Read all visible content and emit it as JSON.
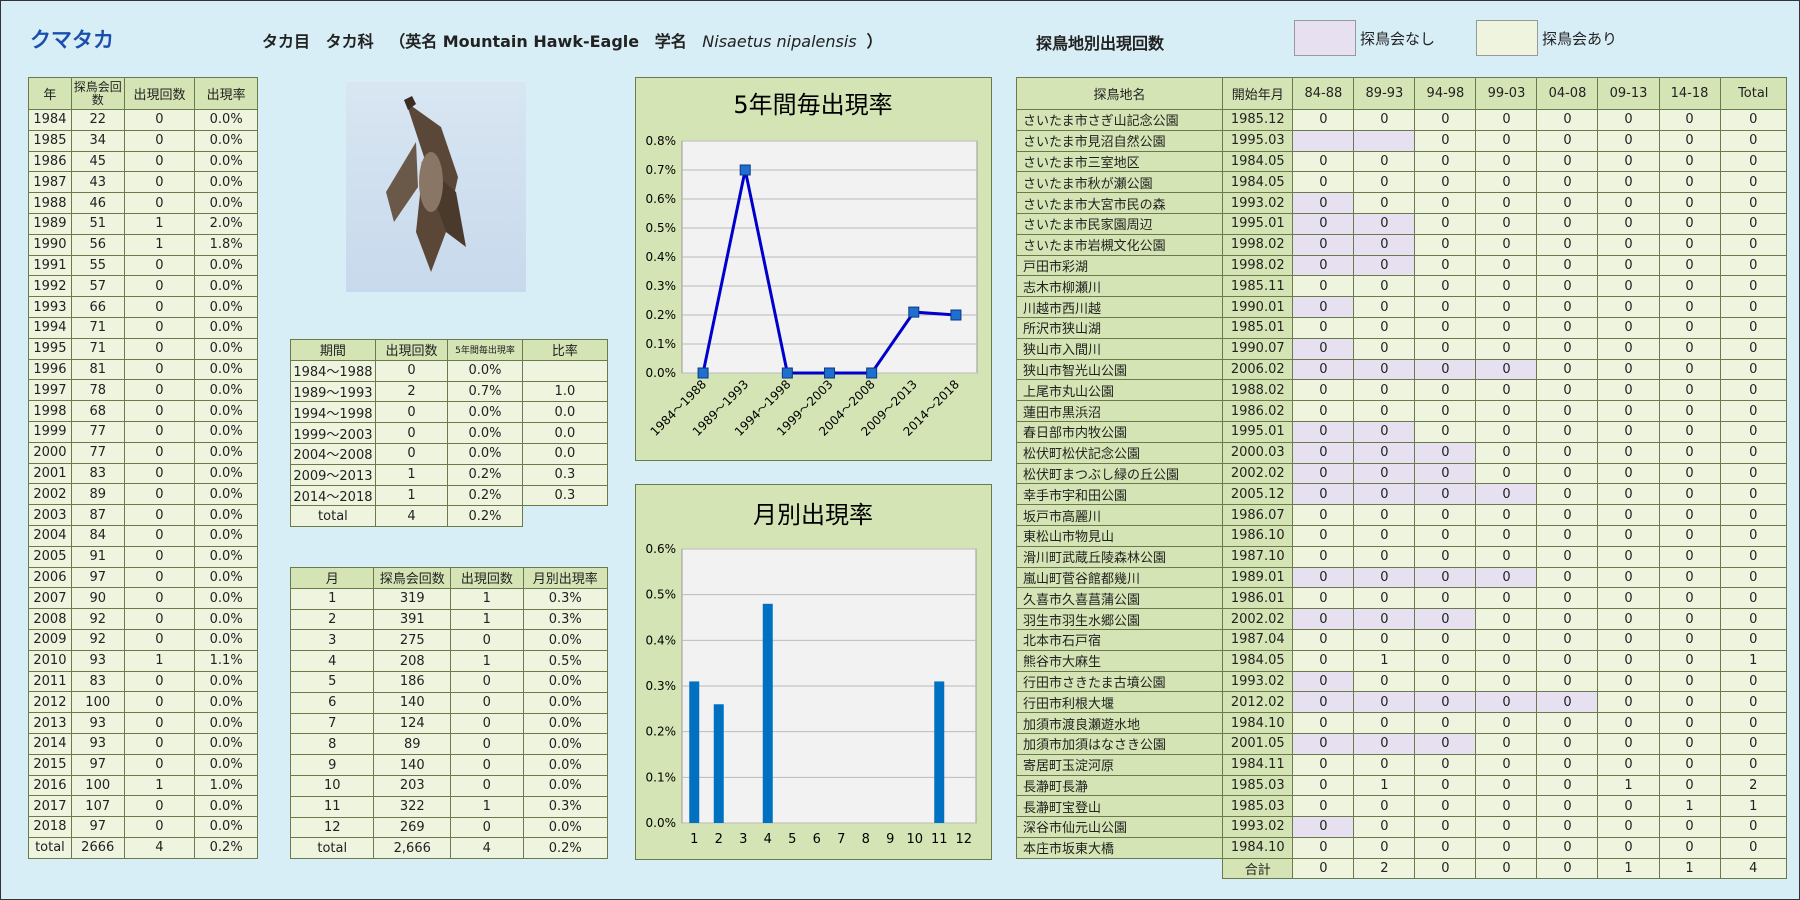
{
  "species": {
    "title": "クマタカ",
    "order": "タカ目",
    "family": "タカ科",
    "english": "（英名 Mountain Hawk-Eagle",
    "sci_prefix": "学名",
    "sci_name": "Nisaetus nipalensis",
    "sci_suffix": "）"
  },
  "site_title": "探鳥地別出現回数",
  "legend": [
    {
      "label": "探鳥会なし",
      "color": "#e6e0f0"
    },
    {
      "label": "探鳥会あり",
      "color": "#eef4de"
    }
  ],
  "year_table": {
    "headers": [
      "年",
      "探鳥会回数",
      "出現回数",
      "出現率"
    ],
    "rows": [
      [
        "1984",
        "22",
        "0",
        "0.0%"
      ],
      [
        "1985",
        "34",
        "0",
        "0.0%"
      ],
      [
        "1986",
        "45",
        "0",
        "0.0%"
      ],
      [
        "1987",
        "43",
        "0",
        "0.0%"
      ],
      [
        "1988",
        "46",
        "0",
        "0.0%"
      ],
      [
        "1989",
        "51",
        "1",
        "2.0%"
      ],
      [
        "1990",
        "56",
        "1",
        "1.8%"
      ],
      [
        "1991",
        "55",
        "0",
        "0.0%"
      ],
      [
        "1992",
        "57",
        "0",
        "0.0%"
      ],
      [
        "1993",
        "66",
        "0",
        "0.0%"
      ],
      [
        "1994",
        "71",
        "0",
        "0.0%"
      ],
      [
        "1995",
        "71",
        "0",
        "0.0%"
      ],
      [
        "1996",
        "81",
        "0",
        "0.0%"
      ],
      [
        "1997",
        "78",
        "0",
        "0.0%"
      ],
      [
        "1998",
        "68",
        "0",
        "0.0%"
      ],
      [
        "1999",
        "77",
        "0",
        "0.0%"
      ],
      [
        "2000",
        "77",
        "0",
        "0.0%"
      ],
      [
        "2001",
        "83",
        "0",
        "0.0%"
      ],
      [
        "2002",
        "89",
        "0",
        "0.0%"
      ],
      [
        "2003",
        "87",
        "0",
        "0.0%"
      ],
      [
        "2004",
        "84",
        "0",
        "0.0%"
      ],
      [
        "2005",
        "91",
        "0",
        "0.0%"
      ],
      [
        "2006",
        "97",
        "0",
        "0.0%"
      ],
      [
        "2007",
        "90",
        "0",
        "0.0%"
      ],
      [
        "2008",
        "92",
        "0",
        "0.0%"
      ],
      [
        "2009",
        "92",
        "0",
        "0.0%"
      ],
      [
        "2010",
        "93",
        "1",
        "1.1%"
      ],
      [
        "2011",
        "83",
        "0",
        "0.0%"
      ],
      [
        "2012",
        "100",
        "0",
        "0.0%"
      ],
      [
        "2013",
        "93",
        "0",
        "0.0%"
      ],
      [
        "2014",
        "93",
        "0",
        "0.0%"
      ],
      [
        "2015",
        "97",
        "0",
        "0.0%"
      ],
      [
        "2016",
        "100",
        "1",
        "1.0%"
      ],
      [
        "2017",
        "107",
        "0",
        "0.0%"
      ],
      [
        "2018",
        "97",
        "0",
        "0.0%"
      ],
      [
        "total",
        "2666",
        "4",
        "0.2%"
      ]
    ]
  },
  "period_table": {
    "headers": [
      "期間",
      "出現回数",
      "5年間毎出現率",
      "比率"
    ],
    "rows": [
      [
        "1984～1988",
        "0",
        "0.0%",
        ""
      ],
      [
        "1989～1993",
        "2",
        "0.7%",
        "1.0"
      ],
      [
        "1994～1998",
        "0",
        "0.0%",
        "0.0"
      ],
      [
        "1999～2003",
        "0",
        "0.0%",
        "0.0"
      ],
      [
        "2004～2008",
        "0",
        "0.0%",
        "0.0"
      ],
      [
        "2009～2013",
        "1",
        "0.2%",
        "0.3"
      ],
      [
        "2014～2018",
        "1",
        "0.2%",
        "0.3"
      ]
    ],
    "total": [
      "total",
      "4",
      "0.2%"
    ]
  },
  "month_table": {
    "headers": [
      "月",
      "探鳥会回数",
      "出現回数",
      "月別出現率"
    ],
    "rows": [
      [
        "1",
        "319",
        "1",
        "0.3%"
      ],
      [
        "2",
        "391",
        "1",
        "0.3%"
      ],
      [
        "3",
        "275",
        "0",
        "0.0%"
      ],
      [
        "4",
        "208",
        "1",
        "0.5%"
      ],
      [
        "5",
        "186",
        "0",
        "0.0%"
      ],
      [
        "6",
        "140",
        "0",
        "0.0%"
      ],
      [
        "7",
        "124",
        "0",
        "0.0%"
      ],
      [
        "8",
        "89",
        "0",
        "0.0%"
      ],
      [
        "9",
        "140",
        "0",
        "0.0%"
      ],
      [
        "10",
        "203",
        "0",
        "0.0%"
      ],
      [
        "11",
        "322",
        "1",
        "0.3%"
      ],
      [
        "12",
        "269",
        "0",
        "0.0%"
      ],
      [
        "total",
        "2,666",
        "4",
        "0.2%"
      ]
    ]
  },
  "site_table": {
    "headers": [
      "探鳥地名",
      "開始年月",
      "84-88",
      "89-93",
      "94-98",
      "99-03",
      "04-08",
      "09-13",
      "14-18",
      "Total"
    ],
    "rows": [
      {
        "name": "さいたま市さぎ山記念公園",
        "start": "1985.12",
        "v": [
          "0",
          "0",
          "0",
          "0",
          "0",
          "0",
          "0",
          "0"
        ],
        "none": 0
      },
      {
        "name": "さいたま市見沼自然公園",
        "start": "1995.03",
        "v": [
          "",
          "",
          "0",
          "0",
          "0",
          "0",
          "0",
          "0"
        ],
        "none": 2
      },
      {
        "name": "さいたま市三室地区",
        "start": "1984.05",
        "v": [
          "0",
          "0",
          "0",
          "0",
          "0",
          "0",
          "0",
          "0"
        ],
        "none": 0
      },
      {
        "name": "さいたま市秋が瀬公園",
        "start": "1984.05",
        "v": [
          "0",
          "0",
          "0",
          "0",
          "0",
          "0",
          "0",
          "0"
        ],
        "none": 0
      },
      {
        "name": "さいたま市大宮市民の森",
        "start": "1993.02",
        "v": [
          "0",
          "0",
          "0",
          "0",
          "0",
          "0",
          "0",
          "0"
        ],
        "none": 1
      },
      {
        "name": "さいたま市民家園周辺",
        "start": "1995.01",
        "v": [
          "0",
          "0",
          "0",
          "0",
          "0",
          "0",
          "0",
          "0"
        ],
        "none": 2
      },
      {
        "name": "さいたま市岩槻文化公園",
        "start": "1998.02",
        "v": [
          "0",
          "0",
          "0",
          "0",
          "0",
          "0",
          "0",
          "0"
        ],
        "none": 2
      },
      {
        "name": "戸田市彩湖",
        "start": "1998.02",
        "v": [
          "0",
          "0",
          "0",
          "0",
          "0",
          "0",
          "0",
          "0"
        ],
        "none": 2
      },
      {
        "name": "志木市柳瀬川",
        "start": "1985.11",
        "v": [
          "0",
          "0",
          "0",
          "0",
          "0",
          "0",
          "0",
          "0"
        ],
        "none": 0
      },
      {
        "name": "川越市西川越",
        "start": "1990.01",
        "v": [
          "0",
          "0",
          "0",
          "0",
          "0",
          "0",
          "0",
          "0"
        ],
        "none": 1
      },
      {
        "name": "所沢市狭山湖",
        "start": "1985.01",
        "v": [
          "0",
          "0",
          "0",
          "0",
          "0",
          "0",
          "0",
          "0"
        ],
        "none": 0
      },
      {
        "name": "狭山市入間川",
        "start": "1990.07",
        "v": [
          "0",
          "0",
          "0",
          "0",
          "0",
          "0",
          "0",
          "0"
        ],
        "none": 1
      },
      {
        "name": "狭山市智光山公園",
        "start": "2006.02",
        "v": [
          "0",
          "0",
          "0",
          "0",
          "0",
          "0",
          "0",
          "0"
        ],
        "none": 4
      },
      {
        "name": "上尾市丸山公園",
        "start": "1988.02",
        "v": [
          "0",
          "0",
          "0",
          "0",
          "0",
          "0",
          "0",
          "0"
        ],
        "none": 0
      },
      {
        "name": "蓮田市黒浜沼",
        "start": "1986.02",
        "v": [
          "0",
          "0",
          "0",
          "0",
          "0",
          "0",
          "0",
          "0"
        ],
        "none": 0
      },
      {
        "name": "春日部市内牧公園",
        "start": "1995.01",
        "v": [
          "0",
          "0",
          "0",
          "0",
          "0",
          "0",
          "0",
          "0"
        ],
        "none": 2
      },
      {
        "name": "松伏町松伏記念公園",
        "start": "2000.03",
        "v": [
          "0",
          "0",
          "0",
          "0",
          "0",
          "0",
          "0",
          "0"
        ],
        "none": 3
      },
      {
        "name": "松伏町まつぶし緑の丘公園",
        "start": "2002.02",
        "v": [
          "0",
          "0",
          "0",
          "0",
          "0",
          "0",
          "0",
          "0"
        ],
        "none": 3
      },
      {
        "name": "幸手市宇和田公園",
        "start": "2005.12",
        "v": [
          "0",
          "0",
          "0",
          "0",
          "0",
          "0",
          "0",
          "0"
        ],
        "none": 4
      },
      {
        "name": "坂戸市高麗川",
        "start": "1986.07",
        "v": [
          "0",
          "0",
          "0",
          "0",
          "0",
          "0",
          "0",
          "0"
        ],
        "none": 0
      },
      {
        "name": "東松山市物見山",
        "start": "1986.10",
        "v": [
          "0",
          "0",
          "0",
          "0",
          "0",
          "0",
          "0",
          "0"
        ],
        "none": 0
      },
      {
        "name": "滑川町武蔵丘陵森林公園",
        "start": "1987.10",
        "v": [
          "0",
          "0",
          "0",
          "0",
          "0",
          "0",
          "0",
          "0"
        ],
        "none": 0
      },
      {
        "name": "嵐山町菅谷館都幾川",
        "start": "1989.01",
        "v": [
          "0",
          "0",
          "0",
          "0",
          "0",
          "0",
          "0",
          "0"
        ],
        "none": 4
      },
      {
        "name": "久喜市久喜菖蒲公園",
        "start": "1986.01",
        "v": [
          "0",
          "0",
          "0",
          "0",
          "0",
          "0",
          "0",
          "0"
        ],
        "none": 0
      },
      {
        "name": "羽生市羽生水郷公園",
        "start": "2002.02",
        "v": [
          "0",
          "0",
          "0",
          "0",
          "0",
          "0",
          "0",
          "0"
        ],
        "none": 3
      },
      {
        "name": "北本市石戸宿",
        "start": "1987.04",
        "v": [
          "0",
          "0",
          "0",
          "0",
          "0",
          "0",
          "0",
          "0"
        ],
        "none": 0
      },
      {
        "name": "熊谷市大麻生",
        "start": "1984.05",
        "v": [
          "0",
          "1",
          "0",
          "0",
          "0",
          "0",
          "0",
          "1"
        ],
        "none": 0
      },
      {
        "name": "行田市さきたま古墳公園",
        "start": "1993.02",
        "v": [
          "0",
          "0",
          "0",
          "0",
          "0",
          "0",
          "0",
          "0"
        ],
        "none": 1
      },
      {
        "name": "行田市利根大堰",
        "start": "2012.02",
        "v": [
          "0",
          "0",
          "0",
          "0",
          "0",
          "0",
          "0",
          "0"
        ],
        "none": 5
      },
      {
        "name": "加須市渡良瀬遊水地",
        "start": "1984.10",
        "v": [
          "0",
          "0",
          "0",
          "0",
          "0",
          "0",
          "0",
          "0"
        ],
        "none": 0
      },
      {
        "name": "加須市加須はなさき公園",
        "start": "2001.05",
        "v": [
          "0",
          "0",
          "0",
          "0",
          "0",
          "0",
          "0",
          "0"
        ],
        "none": 3
      },
      {
        "name": "寄居町玉淀河原",
        "start": "1984.11",
        "v": [
          "0",
          "0",
          "0",
          "0",
          "0",
          "0",
          "0",
          "0"
        ],
        "none": 0
      },
      {
        "name": "長瀞町長瀞",
        "start": "1985.03",
        "v": [
          "0",
          "1",
          "0",
          "0",
          "0",
          "1",
          "0",
          "2"
        ],
        "none": 0
      },
      {
        "name": "長瀞町宝登山",
        "start": "1985.03",
        "v": [
          "0",
          "0",
          "0",
          "0",
          "0",
          "0",
          "1",
          "1"
        ],
        "none": 0
      },
      {
        "name": "深谷市仙元山公園",
        "start": "1993.02",
        "v": [
          "0",
          "0",
          "0",
          "0",
          "0",
          "0",
          "0",
          "0"
        ],
        "none": 1
      },
      {
        "name": "本庄市坂東大橋",
        "start": "1984.10",
        "v": [
          "0",
          "0",
          "0",
          "0",
          "0",
          "0",
          "0",
          "0"
        ],
        "none": 0
      }
    ],
    "total_label": "合計",
    "totals": [
      "0",
      "2",
      "0",
      "0",
      "0",
      "1",
      "1",
      "4"
    ]
  },
  "chart_data": [
    {
      "type": "line",
      "title": "5年間毎出現率",
      "categories": [
        "1984～1988",
        "1989～1993",
        "1994～1998",
        "1999～2003",
        "2004～2008",
        "2009～2013",
        "2014～2018"
      ],
      "values": [
        0.0,
        0.7,
        0.0,
        0.0,
        0.0,
        0.21,
        0.2
      ],
      "ylim": [
        0,
        0.8
      ],
      "yticks": [
        "0.0%",
        "0.1%",
        "0.2%",
        "0.3%",
        "0.4%",
        "0.5%",
        "0.6%",
        "0.7%",
        "0.8%"
      ],
      "color": "#0000cc",
      "grid": true
    },
    {
      "type": "bar",
      "title": "月別出現率",
      "categories": [
        "1",
        "2",
        "3",
        "4",
        "5",
        "6",
        "7",
        "8",
        "9",
        "10",
        "11",
        "12"
      ],
      "values": [
        0.31,
        0.26,
        0,
        0.48,
        0,
        0,
        0,
        0,
        0,
        0,
        0.31,
        0
      ],
      "ylim": [
        0,
        0.6
      ],
      "yticks": [
        "0.0%",
        "0.1%",
        "0.2%",
        "0.3%",
        "0.4%",
        "0.5%",
        "0.6%"
      ],
      "color": "#0070c0",
      "grid": true
    }
  ]
}
